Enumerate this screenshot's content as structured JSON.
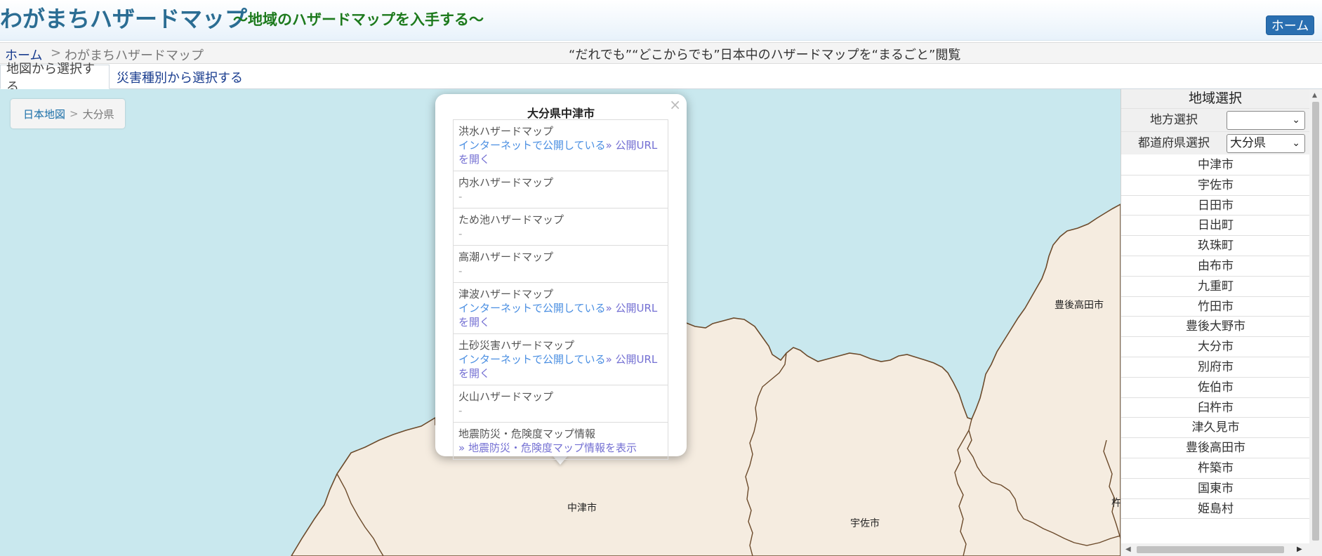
{
  "header": {
    "title": "わがまちハザードマップ",
    "subtitle": "～地域のハザードマップを入手する～",
    "home_button": "ホーム"
  },
  "breadcrumb": {
    "home": "ホーム",
    "separator": ">",
    "current": "わがまちハザードマップ",
    "tagline": "“だれでも”“どこからでも”日本中のハザードマップを“まるごと”閲覧"
  },
  "tabs": [
    {
      "label": "地図から選択する",
      "active": true
    },
    {
      "label": "災害種別から選択する",
      "active": false
    }
  ],
  "map": {
    "breadcrumb": {
      "link": "日本地図",
      "separator": ">",
      "current": "大分県"
    },
    "labels": {
      "nakatsu": "中津市",
      "usa": "宇佐市",
      "bungotakada": "豊後高田市",
      "kitsuki_partial": "杵"
    },
    "colors": {
      "sea": "#c9e8ee",
      "land": "#f5ece0",
      "border": "#6b4a2b"
    }
  },
  "popup": {
    "close": "×",
    "title": "大分県中津市",
    "items": [
      {
        "name": "洪水ハザードマップ",
        "status": "インターネットで公開している",
        "link": "» 公開URLを開く"
      },
      {
        "name": "内水ハザードマップ",
        "status": "-"
      },
      {
        "name": "ため池ハザードマップ",
        "status": "-"
      },
      {
        "name": "高潮ハザードマップ",
        "status": "-"
      },
      {
        "name": "津波ハザードマップ",
        "status": "インターネットで公開している",
        "link": "» 公開URLを開く"
      },
      {
        "name": "土砂災害ハザードマップ",
        "status": "インターネットで公開している",
        "link": "» 公開URLを開く"
      },
      {
        "name": "火山ハザードマップ",
        "status": "-"
      },
      {
        "name": "地震防災・危険度マップ情報",
        "link": "» 地震防災・危険度マップ情報を表示"
      }
    ]
  },
  "sidebar": {
    "heading": "地域選択",
    "region_label": "地方選択",
    "region_value": "",
    "prefecture_label": "都道府県選択",
    "prefecture_value": "大分県",
    "municipalities": [
      "中津市",
      "宇佐市",
      "日田市",
      "日出町",
      "玖珠町",
      "由布市",
      "九重町",
      "竹田市",
      "豊後大野市",
      "大分市",
      "別府市",
      "佐伯市",
      "臼杵市",
      "津久見市",
      "豊後高田市",
      "杵築市",
      "国東市",
      "姫島村"
    ]
  }
}
